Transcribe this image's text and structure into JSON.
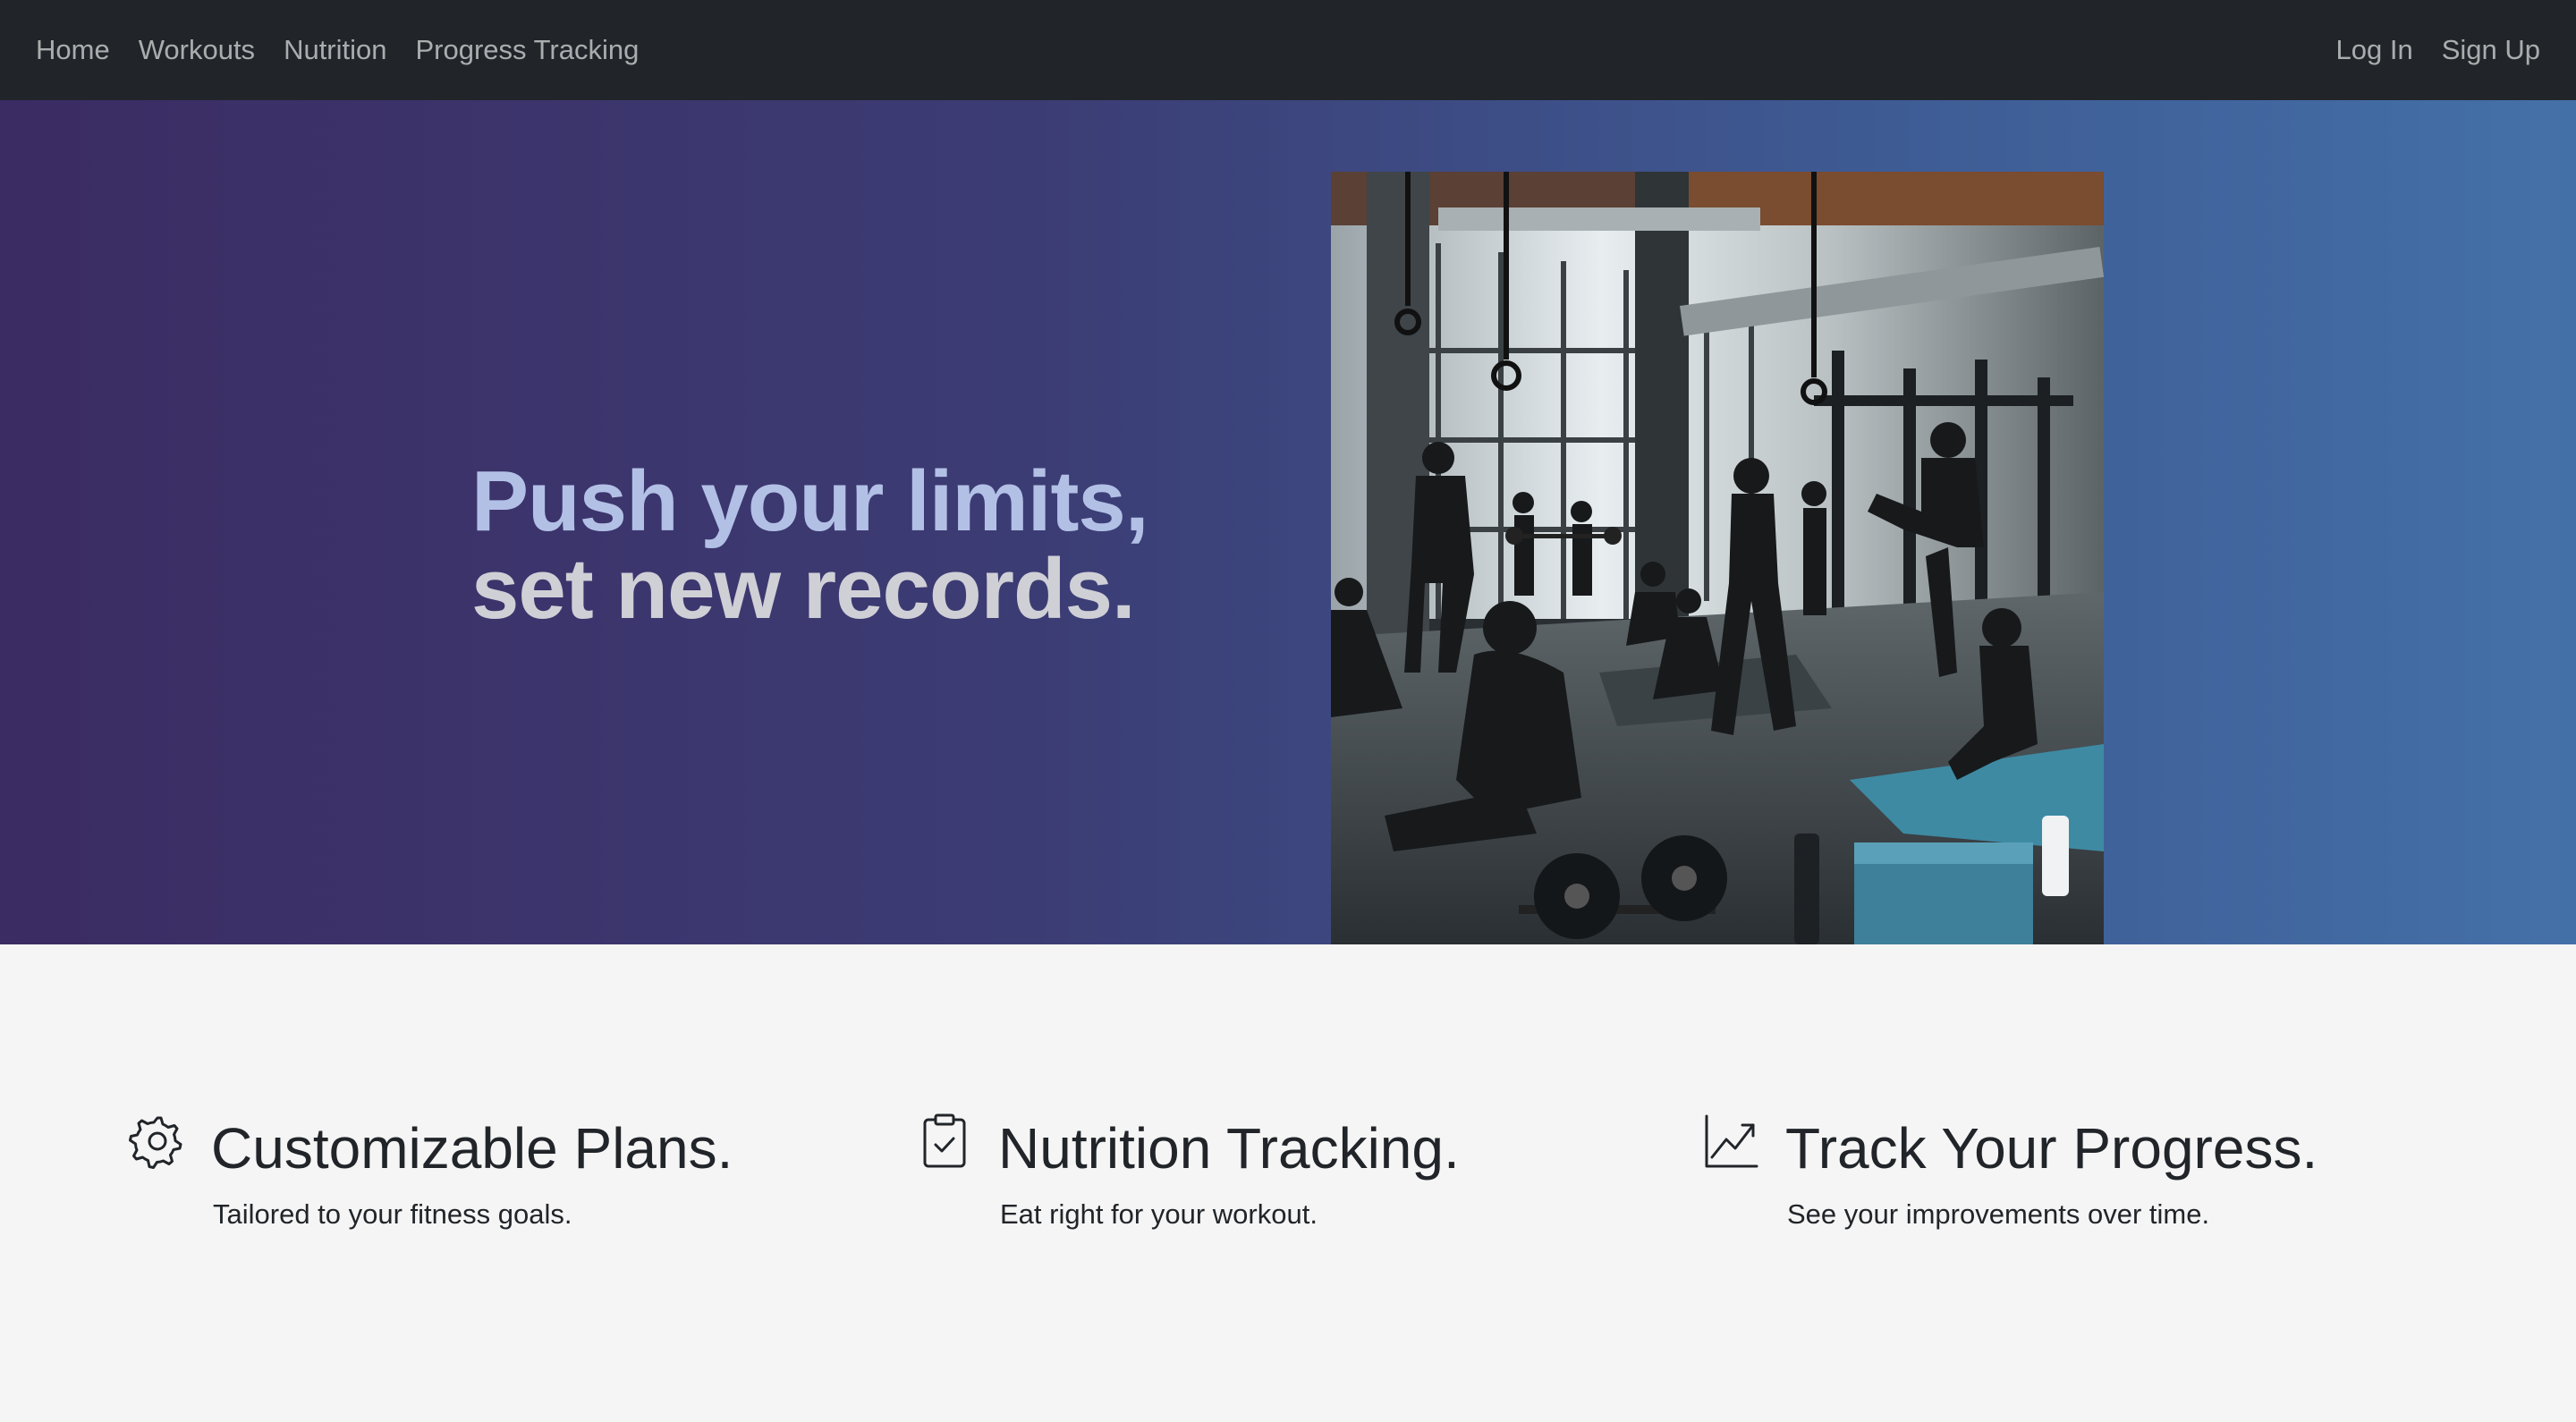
{
  "nav": {
    "left": [
      {
        "label": "Home"
      },
      {
        "label": "Workouts"
      },
      {
        "label": "Nutrition"
      },
      {
        "label": "Progress Tracking"
      }
    ],
    "right": [
      {
        "label": "Log In"
      },
      {
        "label": "Sign Up"
      }
    ]
  },
  "hero": {
    "line1": "Push your limits,",
    "line2": "set new records.",
    "image_icon": "gym-photo"
  },
  "features": [
    {
      "icon": "gear-icon",
      "title": "Customizable Plans.",
      "desc": "Tailored to your fitness goals."
    },
    {
      "icon": "clipboard-check-icon",
      "title": "Nutrition Tracking.",
      "desc": "Eat right for your workout."
    },
    {
      "icon": "graph-up-icon",
      "title": "Track Your Progress.",
      "desc": "See your improvements over time."
    }
  ],
  "colors": {
    "navbar": "#212529",
    "hero_start": "#3b2c63",
    "hero_end": "#4470a8",
    "headline_line1": "#b3c0e6",
    "headline_line2": "#cfcfd6",
    "text": "#212529",
    "background": "#f5f5f5"
  }
}
